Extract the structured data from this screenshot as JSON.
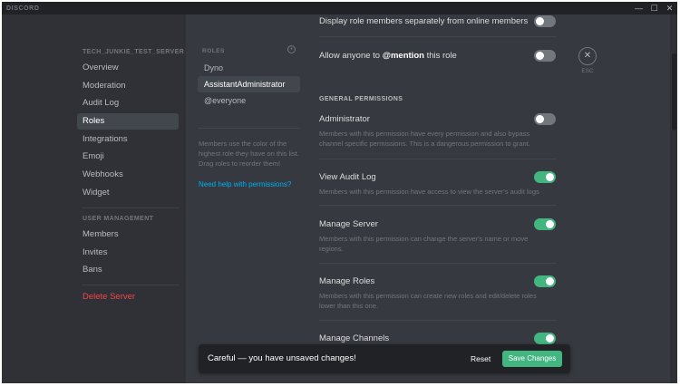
{
  "titlebar": {
    "brand": "DISCORD",
    "minimize_glyph": "—",
    "maximize_glyph": "☐",
    "close_glyph": "✕"
  },
  "sidebar": {
    "server_header": "TECH_JUNKIE_TEST_SERVER",
    "items": [
      {
        "label": "Overview"
      },
      {
        "label": "Moderation"
      },
      {
        "label": "Audit Log"
      },
      {
        "label": "Roles",
        "active": true
      },
      {
        "label": "Integrations"
      },
      {
        "label": "Emoji"
      },
      {
        "label": "Webhooks"
      },
      {
        "label": "Widget"
      }
    ],
    "user_header": "USER MANAGEMENT",
    "user_items": [
      {
        "label": "Members"
      },
      {
        "label": "Invites"
      },
      {
        "label": "Bans"
      }
    ],
    "delete_label": "Delete Server"
  },
  "roles": {
    "header": "ROLES",
    "add_glyph": "+",
    "items": [
      {
        "label": "Dyno"
      },
      {
        "label": "AssistantAdministrator",
        "active": true
      },
      {
        "label": "@everyone"
      }
    ],
    "help_text": "Members use the color of the highest role they have on this list. Drag roles to reorder them!",
    "help_link": "Need help with permissions?"
  },
  "settings": {
    "display_separately": {
      "title": "Display role members separately from online members",
      "enabled": false
    },
    "mention": {
      "title_pre": "Allow anyone to ",
      "title_bold": "@mention",
      "title_post": " this role",
      "enabled": false
    }
  },
  "general_permissions": {
    "header": "GENERAL PERMISSIONS",
    "items": [
      {
        "title": "Administrator",
        "desc": "Members with this permission have every permission and also bypass channel specific permissions. This is a dangerous permission to grant.",
        "enabled": false
      },
      {
        "title": "View Audit Log",
        "desc": "Members with this permission have access to view the server's audit logs",
        "enabled": true
      },
      {
        "title": "Manage Server",
        "desc": "Members with this permission can change the server's name or move regions.",
        "enabled": true
      },
      {
        "title": "Manage Roles",
        "desc": "Members with this permission can create new roles and edit/delete roles lower than this one.",
        "enabled": true
      },
      {
        "title": "Manage Channels",
        "enabled": true
      }
    ]
  },
  "close": {
    "glyph": "✕",
    "label": "ESC"
  },
  "unsaved_bar": {
    "message": "Careful — you have unsaved changes!",
    "reset_label": "Reset",
    "save_label": "Save Changes"
  },
  "colors": {
    "background": "#36393f",
    "sidebar": "#2f3136",
    "titlebar": "#202225",
    "toggle_on": "#43b581",
    "toggle_off": "#72767d",
    "danger": "#f04747",
    "link": "#00b0f4"
  }
}
